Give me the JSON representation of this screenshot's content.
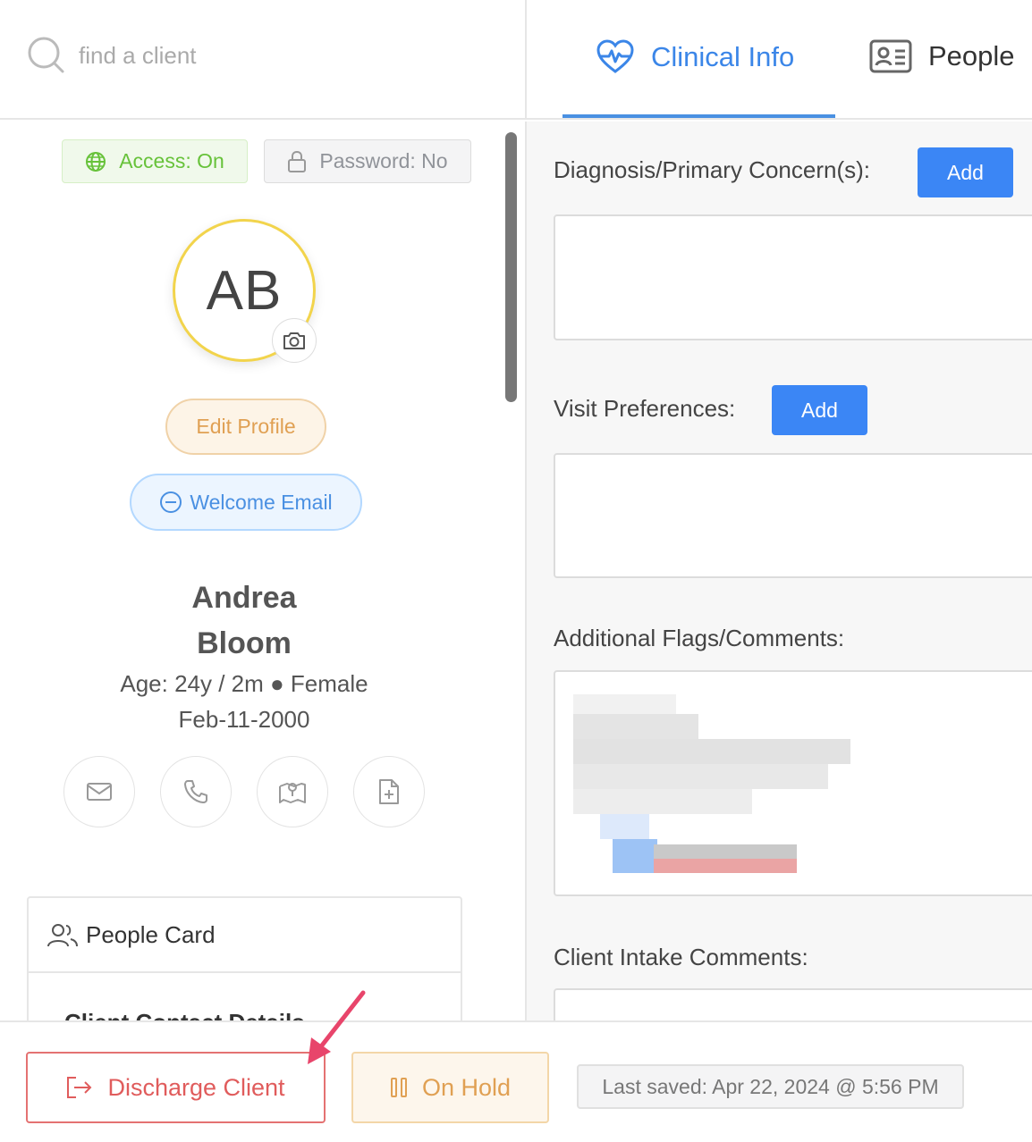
{
  "search": {
    "placeholder": "find a client"
  },
  "tabs": [
    {
      "label": "Clinical Info",
      "icon": "heart-pulse-icon",
      "active": true
    },
    {
      "label": "People",
      "icon": "contact-card-icon",
      "active": false
    }
  ],
  "profile": {
    "access_label": "Access: On",
    "password_label": "Password: No",
    "initials": "AB",
    "edit_label": "Edit Profile",
    "welcome_label": "Welcome Email",
    "first_name": "Andrea",
    "last_name": "Bloom",
    "age_gender": "Age: 24y / 2m ● Female",
    "dob": "Feb-11-2000",
    "contact_icons": [
      "mail-icon",
      "phone-icon",
      "map-icon",
      "document-add-icon"
    ]
  },
  "people_card": {
    "title": "People Card",
    "subtitle": "Client Contact Details"
  },
  "clinical": {
    "diagnosis_label": "Diagnosis/Primary Concern(s):",
    "visit_label": "Visit Preferences:",
    "flags_label": "Additional Flags/Comments:",
    "intake_label": "Client Intake Comments:",
    "add_label": "Add"
  },
  "footer": {
    "discharge_label": "Discharge Client",
    "hold_label": "On Hold",
    "last_saved": "Last saved: Apr 22, 2024 @ 5:56 PM"
  },
  "colors": {
    "accent_blue": "#3b86e8",
    "discharge_red": "#e05c5c",
    "hold_orange": "#e0a053",
    "avatar_ring": "#f2d44c",
    "arrow_pink": "#e8456b"
  }
}
